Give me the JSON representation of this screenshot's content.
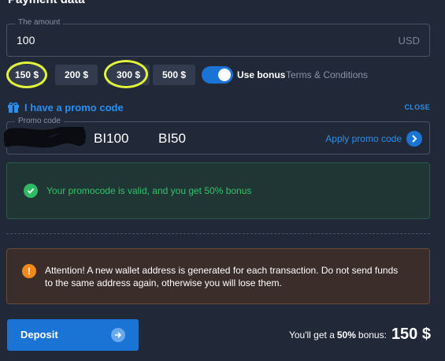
{
  "header": {
    "title": "Payment data"
  },
  "amount": {
    "legend": "The amount",
    "value": "100",
    "currency": "USD"
  },
  "presets": [
    {
      "label": "150 $",
      "highlighted": true
    },
    {
      "label": "200 $",
      "highlighted": false
    },
    {
      "label": "300 $",
      "highlighted": true
    },
    {
      "label": "500 $",
      "highlighted": false
    }
  ],
  "bonus": {
    "enabled": true,
    "label": "Use bonus",
    "terms": "Terms & Conditions"
  },
  "promo": {
    "title": "I have a promo code",
    "close_label": "CLOSE",
    "legend": "Promo code",
    "codes": [
      "BI100",
      "BI50"
    ],
    "apply_label": "Apply promo code"
  },
  "valid": {
    "message": "Your promocode is valid, and you get 50% bonus"
  },
  "warning": {
    "message": "Attention! A new wallet address is generated for each transaction. Do not send funds to the same address again, otherwise you will lose them."
  },
  "deposit": {
    "label": "Deposit"
  },
  "summary": {
    "prefix": "You'll get a",
    "percent": "50%",
    "suffix": "bonus:",
    "amount": "150 $"
  },
  "colors": {
    "accent": "#1a74d6",
    "success": "#33c46b",
    "warning": "#f08a1c",
    "highlight": "#e2f53a"
  }
}
